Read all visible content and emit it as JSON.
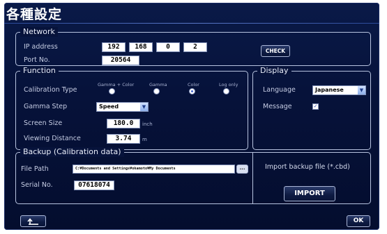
{
  "title": "各種設定",
  "network": {
    "legend": "Network",
    "ip_label": "IP address",
    "ip": [
      "192",
      "168",
      "0",
      "2"
    ],
    "port_label": "Port No.",
    "port": "20564",
    "check_label": "CHECK"
  },
  "function": {
    "legend": "Function",
    "calibration_label": "Calibration Type",
    "calibration_options": [
      "Gamma + Color",
      "Gamma",
      "Color",
      "Log only"
    ],
    "calibration_selected": "Color",
    "gamma_label": "Gamma Step",
    "gamma_value": "Speed",
    "screen_label": "Screen Size",
    "screen_value": "180.0",
    "screen_unit": "inch",
    "distance_label": "Viewing Distance",
    "distance_value": "3.74",
    "distance_unit": "m"
  },
  "display": {
    "legend": "Display",
    "language_label": "Language",
    "language_value": "Japanese",
    "message_label": "Message",
    "message_checked": true
  },
  "backup": {
    "legend": "Backup (Calibration data)",
    "path_label": "File Path",
    "path_value": "C:¥Documents and Settings¥okamoto¥My Documents",
    "browse_label": "...",
    "serial_label": "Serial No.",
    "serial_value": "07618074",
    "import_text": "Import backup file (*.cbd)",
    "import_label": "IMPORT"
  },
  "footer": {
    "back_icon": "return-arrow-icon",
    "ok_label": "OK"
  },
  "colors": {
    "background": "#06123a",
    "border": "#b8c4e0",
    "accent": "#4466cc"
  }
}
